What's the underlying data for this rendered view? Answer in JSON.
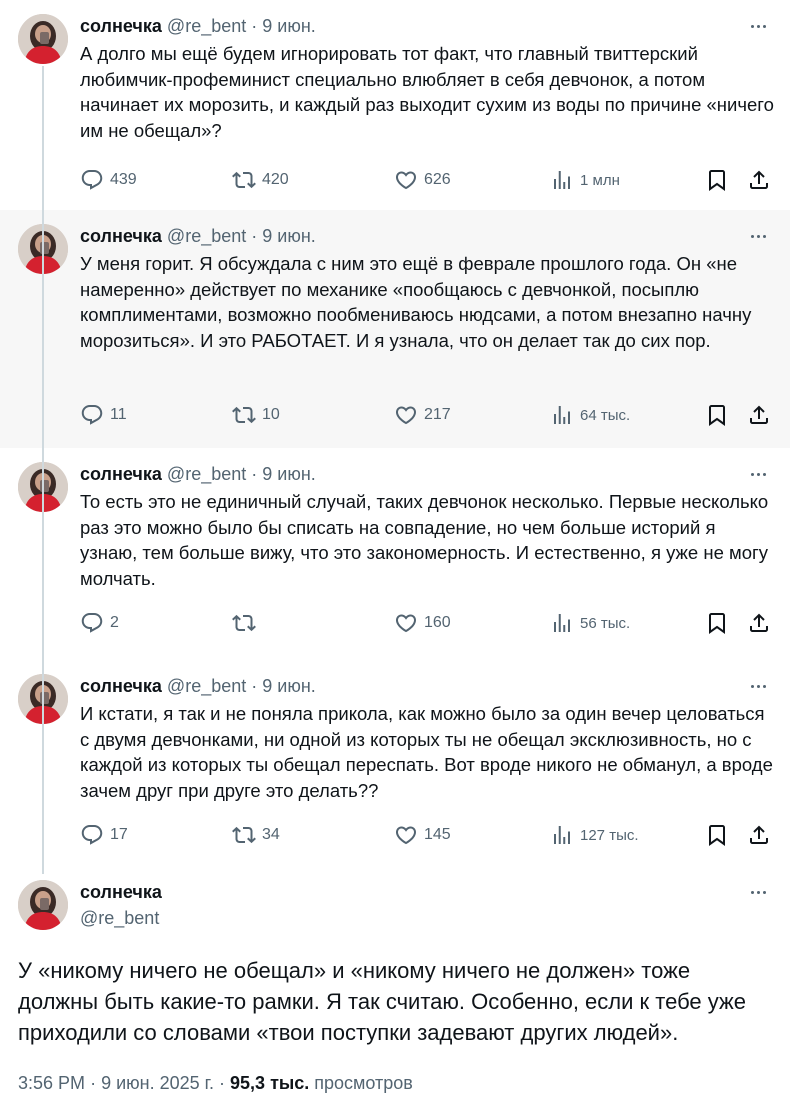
{
  "author": {
    "name": "солнечка",
    "handle": "@re_bent"
  },
  "separator": "·",
  "tweets": [
    {
      "date": "9 июн.",
      "text": "А долго мы ещё будем игнорировать тот факт, что главный твиттерский любимчик-профеминист специально влюбляет в себя девчонок, а потом начинает их морозить, и каждый раз выходит сухим из воды по причине «ничего им не обещал»?",
      "replies": "439",
      "retweets": "420",
      "likes": "626",
      "views": "1 млн"
    },
    {
      "date": "9 июн.",
      "text": "У меня горит. Я обсуждала с ним это ещё в феврале прошлого года. Он «не намеренно» действует по механике «пообщаюсь с девчонкой, посыплю комплиментами, возможно пообмениваюсь нюдсами, а потом внезапно начну морозиться». И это РАБОТАЕТ. И я узнала, что он делает так до сих пор.",
      "replies": "11",
      "retweets": "10",
      "likes": "217",
      "views": "64 тыс."
    },
    {
      "date": "9 июн.",
      "text": "То есть это не единичный случай, таких девчонок несколько. Первые несколько раз это можно было бы списать на совпадение, но чем больше историй я узнаю, тем больше вижу, что это закономерность. И естественно, я уже не могу молчать.",
      "replies": "2",
      "retweets": "",
      "likes": "160",
      "views": "56 тыс."
    },
    {
      "date": "9 июн.",
      "text": "И кстати, я так и не поняла прикола, как можно было за один вечер целоваться с двумя девчонками, ни одной из которых ты не обещал эксклюзивность, но с каждой из которых ты обещал переспать. Вот вроде никого не обманул, а вроде зачем друг при друге это делать??",
      "replies": "17",
      "retweets": "34",
      "likes": "145",
      "views": "127 тыс."
    }
  ],
  "main_tweet": {
    "text": "У «никому ничего не обещал» и «никому ничего не должен» тоже должны быть какие-то рамки. Я так считаю. Особенно, если к тебе уже приходили со словами «твои поступки задевают других людей».",
    "time": "3:56 PM",
    "date": "9 июн. 2025 г.",
    "views_count": "95,3 тыс.",
    "views_label": "просмотров"
  },
  "icons": [
    "reply-icon",
    "retweet-icon",
    "like-icon",
    "views-icon",
    "bookmark-icon",
    "share-icon",
    "more-icon"
  ],
  "colors": {
    "text": "#0f1419",
    "secondary": "#536471",
    "thread_line": "#cfd9de",
    "highlight_bg": "#f7f7f7"
  }
}
